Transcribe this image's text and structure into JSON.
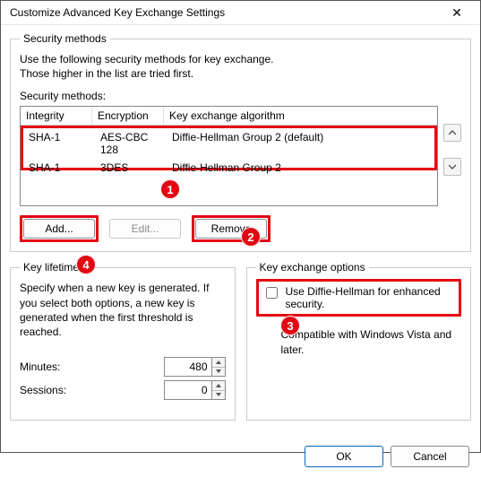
{
  "window": {
    "title": "Customize Advanced Key Exchange Settings"
  },
  "security": {
    "group_label": "Security methods",
    "intro_line1": "Use the following security methods for key exchange.",
    "intro_line2": "Those higher in the list are tried first.",
    "list_label": "Security methods:",
    "columns": {
      "integrity": "Integrity",
      "encryption": "Encryption",
      "algorithm": "Key exchange algorithm"
    },
    "rows": [
      {
        "integrity": "SHA-1",
        "encryption": "AES-CBC 128",
        "algorithm": "Diffie-Hellman Group 2 (default)"
      },
      {
        "integrity": "SHA-1",
        "encryption": "3DES",
        "algorithm": "Diffie-Hellman Group 2"
      }
    ],
    "buttons": {
      "add": "Add...",
      "edit": "Edit...",
      "remove": "Remove"
    }
  },
  "lifetimes": {
    "group_label": "Key lifetimes",
    "desc": "Specify when a new key is generated. If you select both options, a new key is generated when the first threshold is reached.",
    "minutes_label": "Minutes:",
    "minutes_value": "480",
    "sessions_label": "Sessions:",
    "sessions_value": "0"
  },
  "options": {
    "group_label": "Key exchange options",
    "dh_checkbox_label": "Use Diffie-Hellman for enhanced security.",
    "compat_note": "Compatible with Windows Vista and later."
  },
  "footer": {
    "ok": "OK",
    "cancel": "Cancel"
  },
  "callouts": [
    "1",
    "2",
    "3",
    "4"
  ]
}
